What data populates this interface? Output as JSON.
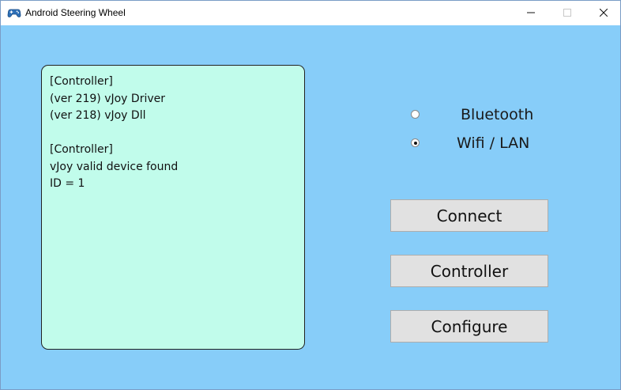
{
  "window": {
    "title": "Android Steering Wheel",
    "app_icon": "gamepad-icon",
    "controls": [
      "minimize-icon",
      "maximize-icon",
      "close-icon"
    ]
  },
  "colors": {
    "client_background": "#87cdf9",
    "log_background": "#c1fceb",
    "button_background": "#e1e1e1",
    "button_border": "#adadad"
  },
  "log": {
    "lines": [
      "[Controller]",
      "(ver 219) vJoy Driver",
      "(ver 218) vJoy Dll",
      "",
      "[Controller]",
      "vJoy valid device found",
      "ID = 1"
    ]
  },
  "connection": {
    "options": [
      {
        "label": "Bluetooth",
        "selected": false
      },
      {
        "label": "Wifi / LAN",
        "selected": true
      }
    ]
  },
  "buttons": {
    "connect": "Connect",
    "controller": "Controller",
    "configure": "Configure"
  }
}
